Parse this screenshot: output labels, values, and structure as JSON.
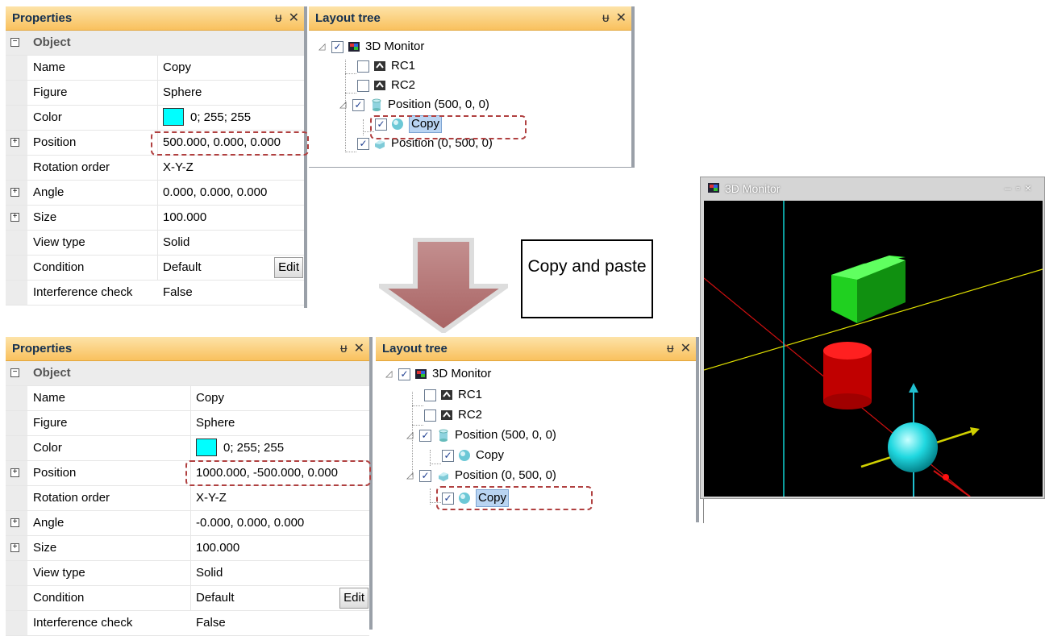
{
  "props_top": {
    "title": "Properties",
    "category": "Object",
    "rows": [
      {
        "name": "Name",
        "value": "Copy"
      },
      {
        "name": "Figure",
        "value": "Sphere"
      },
      {
        "name": "Color",
        "value": "0; 255; 255"
      },
      {
        "name": "Position",
        "value": "500.000, 0.000, 0.000"
      },
      {
        "name": "Rotation order",
        "value": "X-Y-Z"
      },
      {
        "name": "Angle",
        "value": "0.000, 0.000, 0.000"
      },
      {
        "name": "Size",
        "value": "100.000"
      },
      {
        "name": "View type",
        "value": "Solid"
      },
      {
        "name": "Condition",
        "value": "Default"
      },
      {
        "name": "Interference check",
        "value": "False"
      }
    ],
    "edit_label": "Edit"
  },
  "props_bottom": {
    "title": "Properties",
    "category": "Object",
    "rows": [
      {
        "name": "Name",
        "value": "Copy"
      },
      {
        "name": "Figure",
        "value": "Sphere"
      },
      {
        "name": "Color",
        "value": "0; 255; 255"
      },
      {
        "name": "Position",
        "value": "1000.000, -500.000, 0.000"
      },
      {
        "name": "Rotation order",
        "value": "X-Y-Z"
      },
      {
        "name": "Angle",
        "value": "-0.000, 0.000, 0.000"
      },
      {
        "name": "Size",
        "value": "100.000"
      },
      {
        "name": "View type",
        "value": "Solid"
      },
      {
        "name": "Condition",
        "value": "Default"
      },
      {
        "name": "Interference check",
        "value": "False"
      }
    ],
    "edit_label": "Edit"
  },
  "tree_top": {
    "title": "Layout tree",
    "nodes": [
      "3D Monitor",
      "RC1",
      "RC2",
      "Position (500, 0, 0)",
      "Copy",
      "Position (0, 500, 0)"
    ]
  },
  "tree_bottom": {
    "title": "Layout tree",
    "nodes": [
      "3D Monitor",
      "RC1",
      "RC2",
      "Position (500, 0, 0)",
      "Copy",
      "Position (0, 500, 0)",
      "Copy"
    ]
  },
  "callout_text": "Copy and paste",
  "monitor": {
    "title": "3D Monitor"
  },
  "icons": {
    "pin": "pin-icon",
    "close": "close-icon",
    "minimize": "minimize-icon",
    "maximize": "maximize-icon"
  },
  "colors": {
    "header": "#f9c15e",
    "swatch": "#00ffff",
    "arrow": "#b86b6b",
    "highlight": "#b04040"
  }
}
